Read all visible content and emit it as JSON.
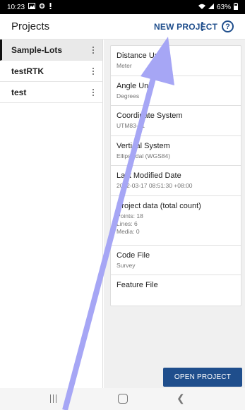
{
  "status_bar": {
    "time": "10:23",
    "battery": "63%",
    "icons": [
      "gallery-icon",
      "settings-icon",
      "notification-icon",
      "wifi-icon",
      "signal-icon",
      "battery-icon"
    ]
  },
  "app_bar": {
    "title": "Projects",
    "new_project_label": "NEW PROJECT",
    "help_glyph": "?"
  },
  "projects": [
    {
      "name": "Sample-Lots",
      "selected": true
    },
    {
      "name": "testRTK",
      "selected": false
    },
    {
      "name": "test",
      "selected": false
    }
  ],
  "details": [
    {
      "label": "Distance Unit",
      "value": "Meter"
    },
    {
      "label": "Angle Unit",
      "value": "Degrees"
    },
    {
      "label": "Coordinate System",
      "value": "UTM83-51"
    },
    {
      "label": "Vertical System",
      "value": "Ellipsoidal (WGS84)"
    },
    {
      "label": "Last Modified Date",
      "value": "2022-03-17 08:51:30 +08:00"
    },
    {
      "label": "Project data (total count)",
      "lines": [
        "Points: 18",
        "Lines: 6",
        "Media: 0"
      ]
    },
    {
      "label": "Code File",
      "value": "Survey"
    },
    {
      "label": "Feature File",
      "value": ""
    }
  ],
  "open_project_label": "OPEN PROJECT",
  "colors": {
    "accent": "#1f4e8c",
    "overlay_arrow": "#a6a6f5"
  }
}
